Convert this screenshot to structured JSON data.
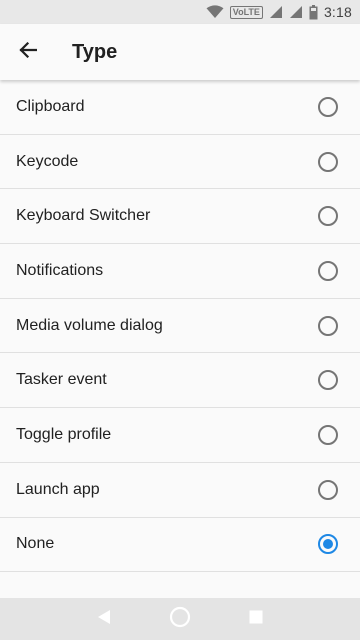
{
  "status_bar": {
    "time": "3:18",
    "network_label": "VoLTE",
    "icons": [
      "wifi-icon",
      "volte-icon",
      "signal-icon",
      "signal-icon",
      "battery-icon"
    ]
  },
  "app_bar": {
    "title": "Type",
    "back_icon": "arrow-back-icon"
  },
  "options": [
    {
      "label": "Clipboard",
      "selected": false
    },
    {
      "label": "Keycode",
      "selected": false
    },
    {
      "label": "Keyboard Switcher",
      "selected": false
    },
    {
      "label": "Notifications",
      "selected": false
    },
    {
      "label": "Media volume dialog",
      "selected": false
    },
    {
      "label": "Tasker event",
      "selected": false
    },
    {
      "label": "Toggle profile",
      "selected": false
    },
    {
      "label": "Launch app",
      "selected": false
    },
    {
      "label": "None",
      "selected": true
    }
  ],
  "nav_bar": {
    "icons": [
      "back-triangle-icon",
      "home-circle-icon",
      "recents-square-icon"
    ]
  },
  "colors": {
    "accent": "#1e88e5",
    "radio_unchecked": "#757575",
    "divider": "#e0e0e0"
  }
}
